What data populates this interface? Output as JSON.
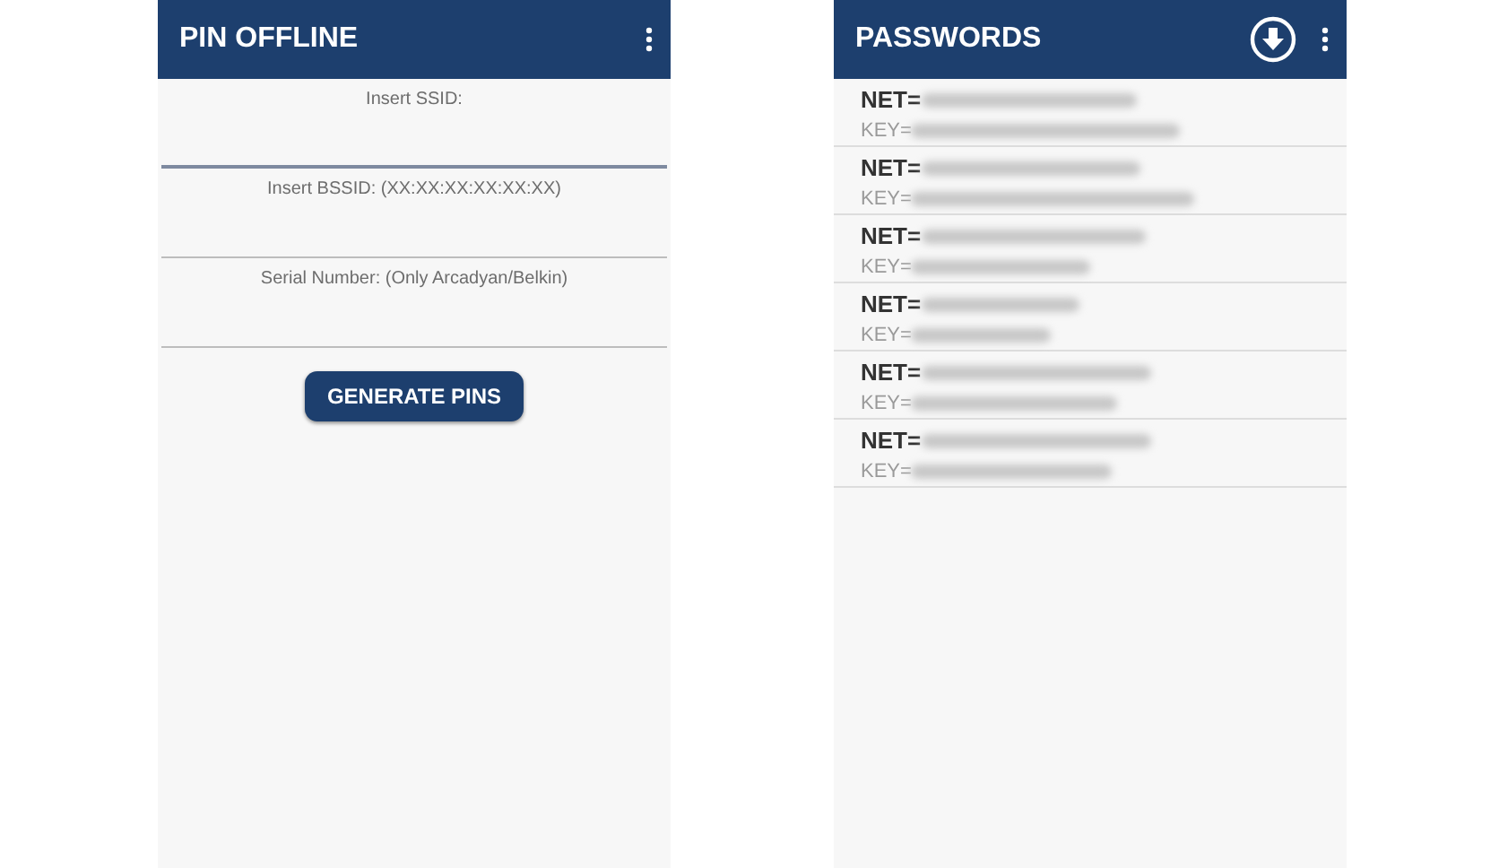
{
  "pin_offline_screen": {
    "title": "PIN OFFLINE",
    "fields": [
      {
        "placeholder": "Insert SSID:",
        "focused": true
      },
      {
        "placeholder": "Insert BSSID: (XX:XX:XX:XX:XX:XX)",
        "focused": false
      },
      {
        "placeholder": "Serial Number: (Only Arcadyan/Belkin)",
        "focused": false
      }
    ],
    "button": "GENERATE PINS"
  },
  "passwords_screen": {
    "title": "PASSWORDS",
    "entries": [
      {
        "net_label": "NET=",
        "key_label": "KEY="
      },
      {
        "net_label": "NET=",
        "key_label": "KEY="
      },
      {
        "net_label": "NET=",
        "key_label": "KEY="
      },
      {
        "net_label": "NET=",
        "key_label": "KEY="
      },
      {
        "net_label": "NET=",
        "key_label": "KEY="
      },
      {
        "net_label": "NET=",
        "key_label": "KEY="
      }
    ]
  }
}
